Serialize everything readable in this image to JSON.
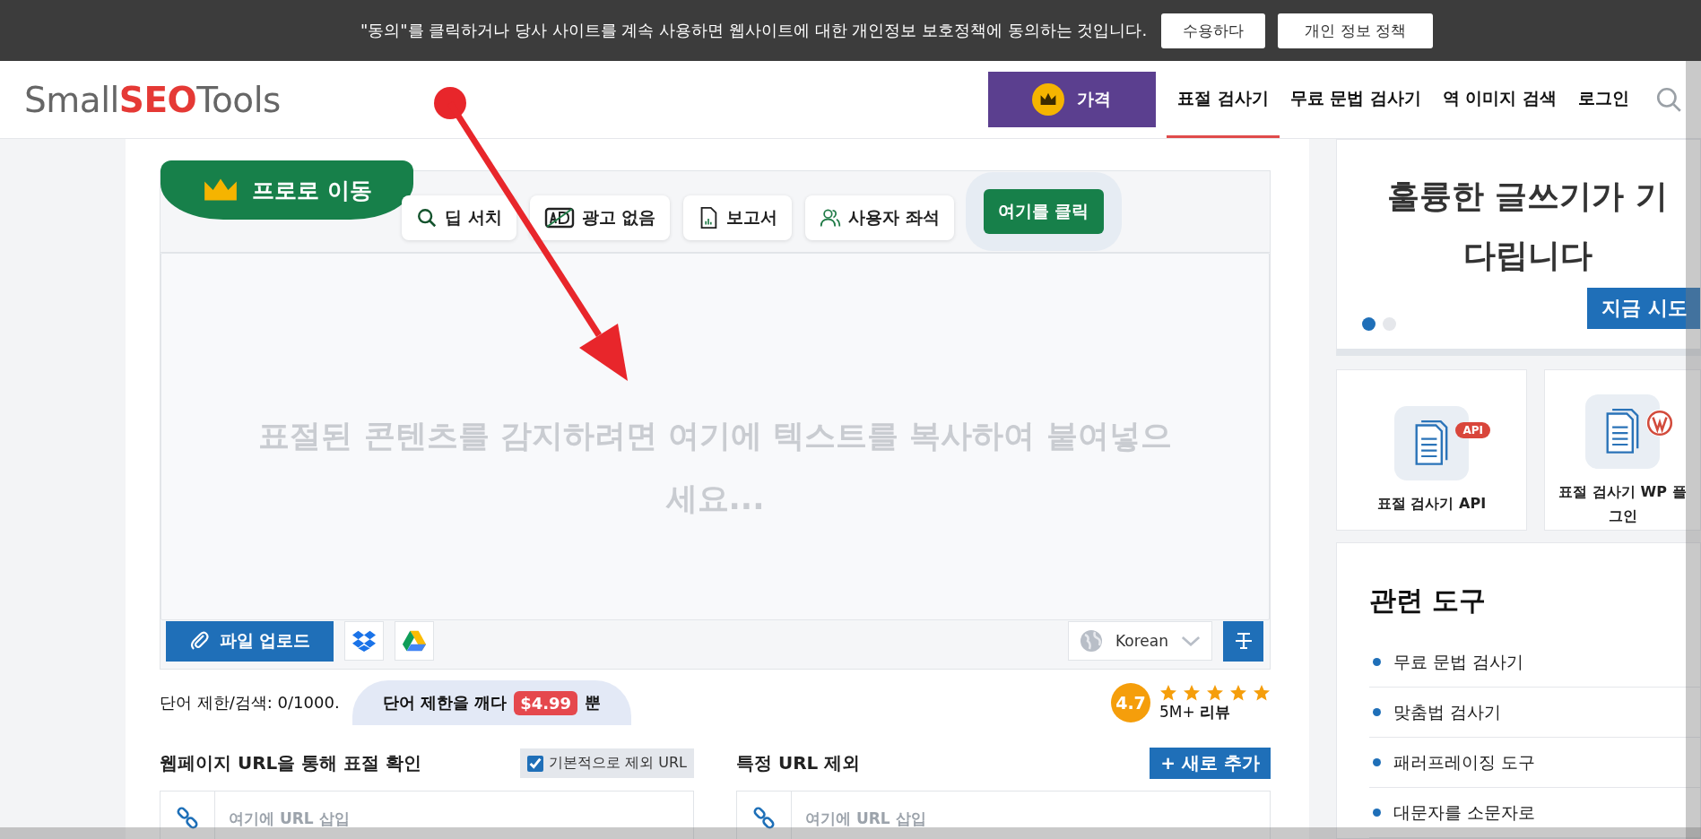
{
  "cookie_banner": {
    "message": "\"동의\"를 클릭하거나 당사 사이트를 계속 사용하면 웹사이트에 대한 개인정보 보호정책에 동의하는 것입니다.",
    "buttons": [
      "수용하다",
      "개인 정보 정책"
    ]
  },
  "header": {
    "logo_parts": [
      "Small",
      "SEO",
      "Tools"
    ],
    "pricing_button": "가격",
    "nav": [
      {
        "label": "표절 검사기",
        "selected": true
      },
      {
        "label": "무료 문법 검사기",
        "selected": false
      },
      {
        "label": "역 이미지 검색",
        "selected": false
      },
      {
        "label": "로그인",
        "selected": false
      }
    ]
  },
  "editor": {
    "pro_ribbon": "프로로 이동",
    "features": [
      {
        "label": "딥 서치",
        "kind": "search"
      },
      {
        "label": "광고 없음",
        "kind": "ad"
      },
      {
        "label": "보고서",
        "kind": "report"
      },
      {
        "label": "사용자 좌석",
        "kind": "users"
      }
    ],
    "cta": "여기를 클릭",
    "placeholder": "표절된 콘텐츠를 감지하려면 여기에 텍스트를 복사하여 붙여넣으세요...",
    "upload_button": "파일 업로드",
    "language": "Korean"
  },
  "word_limit": {
    "label": "단어 제한/검색: 0/1000.",
    "promo_text": "단어 제한을 깨다",
    "price": "$4.99",
    "suffix": "뿐"
  },
  "rating": {
    "score": "4.7",
    "stars": 5,
    "reviews": "5M+ **리뷰**"
  },
  "url_check": {
    "title": "웹페이지 URL을 통해 표절 확인",
    "exclude_default": {
      "label": "기본적으로 제외 URL",
      "checked": true
    },
    "placeholder": "여기에 URL 삽입"
  },
  "exclude_urls": {
    "title": "특정 URL 제외",
    "add_button": "+ 새로 추가",
    "placeholder": "여기에 URL 삽입"
  },
  "sidebar": {
    "promo": {
      "headline": "훌륭한 글쓰기가 기다립니다",
      "button": "지금 시도",
      "slides": [
        {
          "selected": true
        },
        {
          "selected": false
        }
      ]
    },
    "cards": [
      {
        "label_lines": [
          "표절 검사기 API"
        ],
        "badge": "API",
        "kind": "api"
      },
      {
        "label_lines": [
          "표절 검사기 WP 플",
          "그인"
        ],
        "kind": "wordpress"
      }
    ],
    "related": {
      "title": "관련 도구",
      "items": [
        "무료 문법 검사기",
        "맞춤법 검사기",
        "패러프레이징 도구",
        "대문자를 소문자로"
      ]
    }
  }
}
